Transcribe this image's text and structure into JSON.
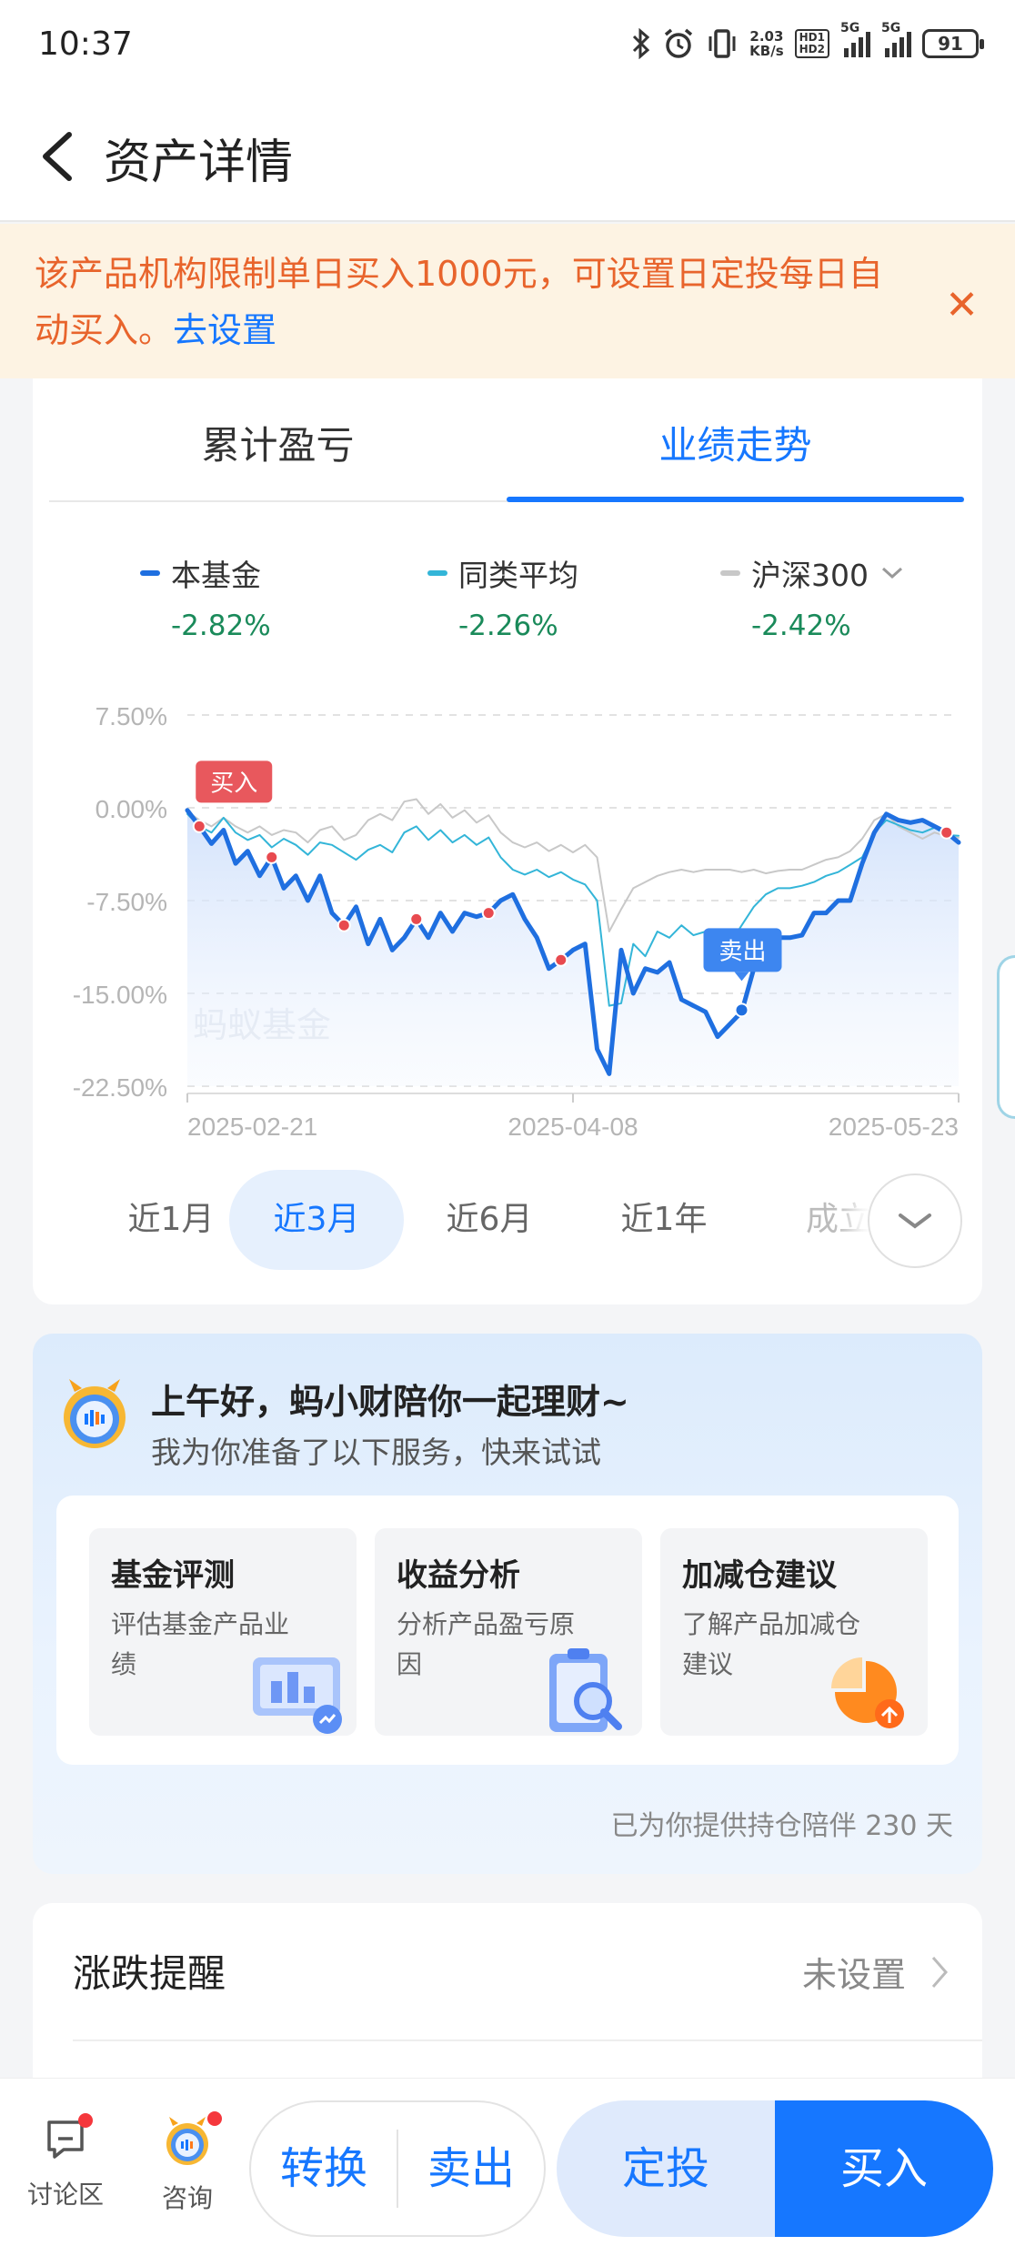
{
  "status_bar": {
    "time": "10:37",
    "net_speed_value": "2.03",
    "net_speed_unit": "KB/s",
    "hd1": "HD1",
    "hd2": "HD2",
    "sim1": "5G",
    "sim2": "5G",
    "battery": "91",
    "icons": [
      "bluetooth-icon",
      "alarm-icon",
      "vibrate-icon",
      "signal-icon",
      "battery-icon"
    ]
  },
  "header": {
    "title": "资产详情"
  },
  "notice": {
    "text": "该产品机构限制单日买入1000元，可设置日定投每日自动买入。",
    "link": "去设置",
    "close_glyph": "✕",
    "text_color": "#e8642c"
  },
  "tabs": [
    {
      "label": "累计盈亏"
    },
    {
      "label": "业绩走势"
    }
  ],
  "legend": [
    {
      "name": "本基金",
      "value": "-2.82%",
      "color": "#1f6fe0"
    },
    {
      "name": "同类平均",
      "value": "-2.26%",
      "color": "#33b5d8"
    },
    {
      "name": "沪深300",
      "value": "-2.42%",
      "color": "#c8c8c8"
    }
  ],
  "chart_data": {
    "type": "line",
    "y_ticks": [
      "7.50%",
      "0.00%",
      "-7.50%",
      "-15.00%",
      "-22.50%"
    ],
    "ylim": [
      -22.5,
      7.5
    ],
    "x_ticks": [
      "2025-02-21",
      "2025-04-08",
      "2025-05-23"
    ],
    "watermark": "蚂蚁基金",
    "buy_label": "买入",
    "sell_label": "卖出",
    "grid": true,
    "series": [
      {
        "name": "本基金",
        "color": "#1f6fe0",
        "values": [
          -0.2,
          -1.5,
          -2.9,
          -1.8,
          -4.5,
          -3.5,
          -5.5,
          -4.0,
          -6.5,
          -5.5,
          -7.5,
          -5.5,
          -8.5,
          -9.5,
          -8.0,
          -11.0,
          -9.0,
          -11.5,
          -10.5,
          -9.0,
          -10.5,
          -8.5,
          -10.0,
          -8.5,
          -8.8,
          -8.5,
          -7.5,
          -7.0,
          -9.0,
          -10.5,
          -13.0,
          -12.3,
          -11.5,
          -11.0,
          -19.5,
          -21.5,
          -11.5,
          -15.0,
          -13.0,
          -13.3,
          -12.5,
          -15.5,
          -16.0,
          -16.5,
          -18.5,
          -17.5,
          -16.5,
          -13.0,
          -11.5,
          -10.5,
          -10.5,
          -10.3,
          -8.5,
          -8.5,
          -7.5,
          -7.5,
          -4.5,
          -2.0,
          -0.5,
          -1.0,
          -1.2,
          -1.0,
          -1.5,
          -2.0,
          -2.8
        ]
      },
      {
        "name": "同类平均",
        "color": "#33b5d8",
        "values": [
          -0.5,
          -1.5,
          -2.0,
          -0.8,
          -2.0,
          -2.6,
          -2.2,
          -3.2,
          -2.5,
          -3.0,
          -3.8,
          -2.8,
          -3.0,
          -3.6,
          -4.2,
          -3.4,
          -3.0,
          -3.6,
          -2.0,
          -1.5,
          -2.6,
          -1.8,
          -2.8,
          -2.2,
          -3.0,
          -2.4,
          -4.0,
          -5.0,
          -5.4,
          -5.0,
          -5.6,
          -5.2,
          -5.8,
          -6.2,
          -7.5,
          -16.0,
          -15.8,
          -11.0,
          -12.0,
          -10.0,
          -10.5,
          -9.5,
          -10.3,
          -10.0,
          -11.5,
          -11.0,
          -9.5,
          -8.0,
          -7.0,
          -6.5,
          -6.5,
          -6.3,
          -6.0,
          -5.5,
          -5.2,
          -4.6,
          -4.0,
          -2.0,
          -1.0,
          -1.4,
          -1.8,
          -2.0,
          -1.6,
          -2.2,
          -2.26
        ]
      },
      {
        "name": "沪深300",
        "color": "#c8c8c8",
        "values": [
          -0.3,
          -1.0,
          -1.5,
          -0.8,
          -1.5,
          -2.0,
          -1.5,
          -2.2,
          -1.8,
          -2.0,
          -2.8,
          -1.8,
          -1.5,
          -2.6,
          -2.2,
          -1.0,
          -0.5,
          -1.0,
          0.5,
          0.7,
          -0.5,
          0.3,
          -0.8,
          -0.2,
          -1.2,
          -0.6,
          -2.0,
          -2.8,
          -3.2,
          -2.8,
          -3.5,
          -3.0,
          -3.6,
          -3.0,
          -4.0,
          -10.0,
          -8.2,
          -6.5,
          -6.0,
          -5.5,
          -5.2,
          -5.0,
          -5.2,
          -5.0,
          -5.0,
          -5.0,
          -5.2,
          -5.0,
          -5.3,
          -5.1,
          -5.0,
          -5.0,
          -4.6,
          -4.2,
          -4.0,
          -3.5,
          -2.5,
          -1.0,
          -0.5,
          -1.5,
          -2.0,
          -2.5,
          -2.0,
          -2.3,
          -2.42
        ]
      }
    ],
    "buy_points_index": [
      1,
      7,
      13,
      19,
      25,
      31,
      63
    ],
    "sell_point_index": 46
  },
  "periods": [
    {
      "label": "近1月"
    },
    {
      "label": "近3月"
    },
    {
      "label": "近6月"
    },
    {
      "label": "近1年"
    },
    {
      "label": "成立"
    }
  ],
  "assistant": {
    "title": "上午好，蚂小财陪你一起理财~",
    "subtitle": "我为你准备了以下服务，快来试试",
    "services": [
      {
        "title": "基金评测",
        "desc": "评估基金产品业绩"
      },
      {
        "title": "收益分析",
        "desc": "分析产品盈亏原因"
      },
      {
        "title": "加减仓建议",
        "desc": "了解产品加减仓建议"
      }
    ],
    "footer": "已为你提供持仓陪伴 230 天"
  },
  "reminder": {
    "title": "涨跌提醒",
    "status": "未设置"
  },
  "bottom_bar": {
    "discuss_label": "讨论区",
    "consult_label": "咨询",
    "convert_label": "转换",
    "sell_label": "卖出",
    "auto_invest_label": "定投",
    "buy_label": "买入",
    "accent": "#1677ff"
  }
}
